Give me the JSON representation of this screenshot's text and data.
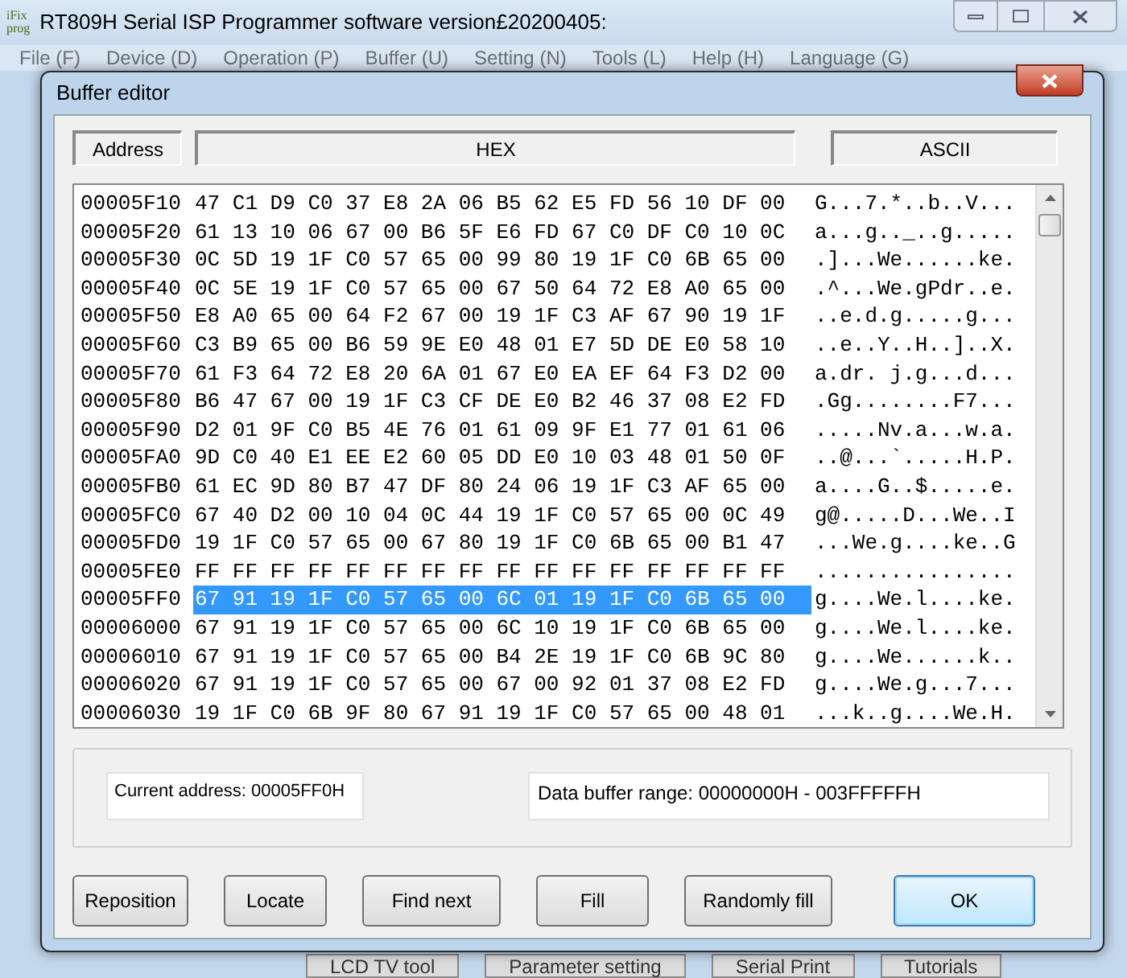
{
  "main_window": {
    "logo": [
      "iFix",
      "prog"
    ],
    "title": "RT809H Serial ISP Programmer software version£20200405:"
  },
  "menu": [
    "File (F)",
    "Device (D)",
    "Operation (P)",
    "Buffer (U)",
    "Setting (N)",
    "Tools (L)",
    "Help (H)",
    "Language (G)"
  ],
  "bottom_tabs": [
    "LCD TV tool",
    "Parameter setting",
    "Serial Print",
    "Tutorials"
  ],
  "dialog": {
    "title": "Buffer editor",
    "columns": [
      "Address",
      "HEX",
      "ASCII"
    ],
    "rows": [
      {
        "address": "00005F10",
        "hex": "47 C1 D9 C0 37 E8 2A 06 B5 62 E5 FD 56 10 DF 00",
        "ascii": "G...7.*..b..V...",
        "selected": false
      },
      {
        "address": "00005F20",
        "hex": "61 13 10 06 67 00 B6 5F E6 FD 67 C0 DF C0 10 0C",
        "ascii": "a...g.._..g.....",
        "selected": false
      },
      {
        "address": "00005F30",
        "hex": "0C 5D 19 1F C0 57 65 00 99 80 19 1F C0 6B 65 00",
        "ascii": ".]...We......ke.",
        "selected": false
      },
      {
        "address": "00005F40",
        "hex": "0C 5E 19 1F C0 57 65 00 67 50 64 72 E8 A0 65 00",
        "ascii": ".^...We.gPdr..e.",
        "selected": false
      },
      {
        "address": "00005F50",
        "hex": "E8 A0 65 00 64 F2 67 00 19 1F C3 AF 67 90 19 1F",
        "ascii": "..e.d.g.....g...",
        "selected": false
      },
      {
        "address": "00005F60",
        "hex": "C3 B9 65 00 B6 59 9E E0 48 01 E7 5D DE E0 58 10",
        "ascii": "..e..Y..H..]..X.",
        "selected": false
      },
      {
        "address": "00005F70",
        "hex": "61 F3 64 72 E8 20 6A 01 67 E0 EA EF 64 F3 D2 00",
        "ascii": "a.dr. j.g...d...",
        "selected": false
      },
      {
        "address": "00005F80",
        "hex": "B6 47 67 00 19 1F C3 CF DE E0 B2 46 37 08 E2 FD",
        "ascii": ".Gg........F7...",
        "selected": false
      },
      {
        "address": "00005F90",
        "hex": "D2 01 9F C0 B5 4E 76 01 61 09 9F E1 77 01 61 06",
        "ascii": ".....Nv.a...w.a.",
        "selected": false
      },
      {
        "address": "00005FA0",
        "hex": "9D C0 40 E1 EE E2 60 05 DD E0 10 03 48 01 50 0F",
        "ascii": "..@...`.....H.P.",
        "selected": false
      },
      {
        "address": "00005FB0",
        "hex": "61 EC 9D 80 B7 47 DF 80 24 06 19 1F C3 AF 65 00",
        "ascii": "a....G..$.....e.",
        "selected": false
      },
      {
        "address": "00005FC0",
        "hex": "67 40 D2 00 10 04 0C 44 19 1F C0 57 65 00 0C 49",
        "ascii": "g@.....D...We..I",
        "selected": false
      },
      {
        "address": "00005FD0",
        "hex": "19 1F C0 57 65 00 67 80 19 1F C0 6B 65 00 B1 47",
        "ascii": "...We.g....ke..G",
        "selected": false
      },
      {
        "address": "00005FE0",
        "hex": "FF FF FF FF FF FF FF FF FF FF FF FF FF FF FF FF",
        "ascii": "................",
        "selected": false
      },
      {
        "address": "00005FF0",
        "hex": "67 91 19 1F C0 57 65 00 6C 01 19 1F C0 6B 65 00",
        "ascii": "g....We.l....ke.",
        "selected": true
      },
      {
        "address": "00006000",
        "hex": "67 91 19 1F C0 57 65 00 6C 10 19 1F C0 6B 65 00",
        "ascii": "g....We.l....ke.",
        "selected": false
      },
      {
        "address": "00006010",
        "hex": "67 91 19 1F C0 57 65 00 B4 2E 19 1F C0 6B 9C 80",
        "ascii": "g....We......k..",
        "selected": false
      },
      {
        "address": "00006020",
        "hex": "67 91 19 1F C0 57 65 00 67 00 92 01 37 08 E2 FD",
        "ascii": "g....We.g...7...",
        "selected": false
      },
      {
        "address": "00006030",
        "hex": "19 1F C0 6B 9F 80 67 91 19 1F C0 57 65 00 48 01",
        "ascii": "...k..g....We.H.",
        "selected": false
      }
    ],
    "current_address": "Current address: 00005FF0H",
    "buffer_range": "Data buffer range: 00000000H - 003FFFFFH",
    "buttons": [
      {
        "label": "Reposition",
        "default": false
      },
      {
        "label": "Locate",
        "default": false
      },
      {
        "label": "Find next",
        "default": false
      },
      {
        "label": "Fill",
        "default": false
      },
      {
        "label": "Randomly fill",
        "default": false
      },
      {
        "label": "OK",
        "default": true
      }
    ]
  }
}
